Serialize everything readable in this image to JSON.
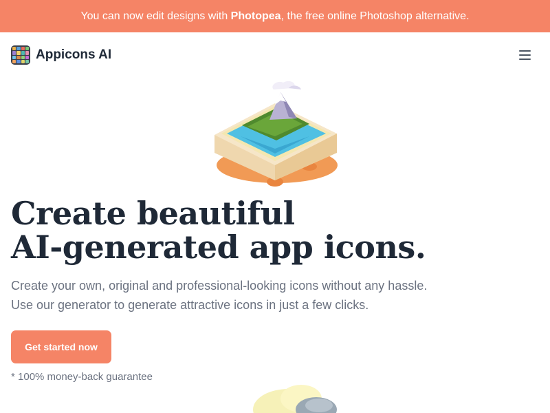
{
  "banner": {
    "text_before": "You can now edit designs with ",
    "link_text": "Photopea",
    "text_after": ", the free online Photoshop alternative.",
    "background_color": "#f58466"
  },
  "header": {
    "brand_name": "Appicons AI",
    "logo_icon": "app-grid-icon",
    "menu_icon": "hamburger-menu-icon"
  },
  "hero": {
    "image_icon": "isometric-mountain-island-icon",
    "headline_line1": "Create beautiful",
    "headline_line2": "AI-generated app icons.",
    "subtitle_line1": "Create your own, original and professional-looking icons without any hassle.",
    "subtitle_line2": "Use our generator to generate attractive icons in just a few clicks.",
    "cta_label": "Get started now",
    "guarantee": "* 100% money-back guarantee",
    "accent_color": "#f58466"
  },
  "below_fold": {
    "image_icon": "isometric-cloud-icon"
  }
}
